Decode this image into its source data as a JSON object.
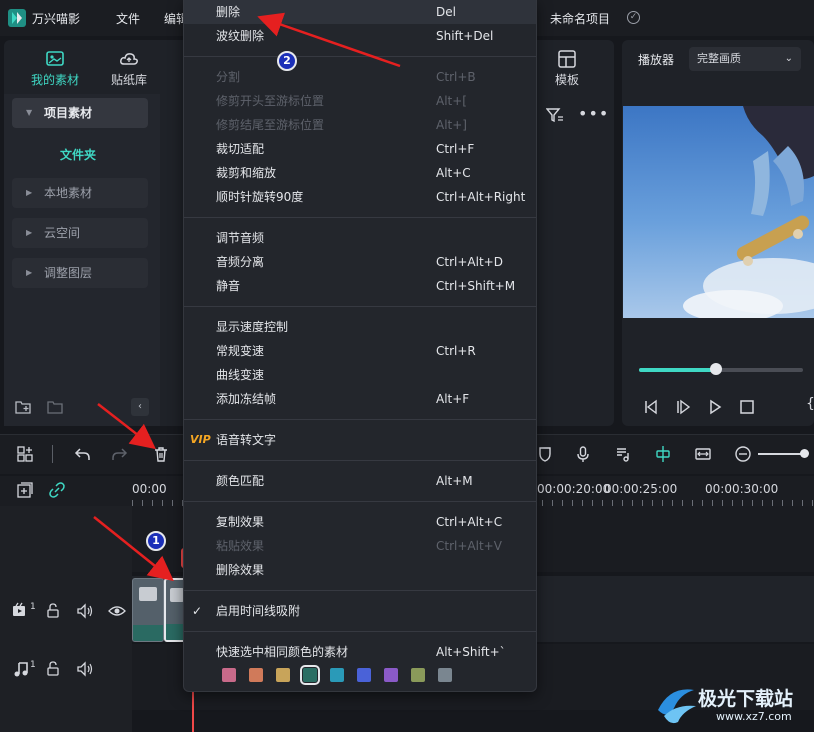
{
  "app": {
    "title": "万兴喵影",
    "menu_file": "文件",
    "menu_edit": "编辑",
    "project_name": "未命名项目",
    "project_saved_icon": "check-circle-icon"
  },
  "library": {
    "tabs": [
      {
        "label": "我的素材",
        "icon": "media-icon"
      },
      {
        "label": "贴纸库",
        "icon": "cloud-icon"
      },
      {
        "label": "模板",
        "icon": "template-icon"
      }
    ],
    "sidebar": {
      "project_media": "项目素材",
      "folder": "文件夹",
      "items": [
        "本地素材",
        "云空间",
        "调整图层"
      ]
    }
  },
  "player": {
    "label": "播放器",
    "quality": "完整画质",
    "progress": 0.47
  },
  "timeline": {
    "ruler": [
      "00:00",
      "00:00:20:00",
      "00:00:25:00",
      "00:00:30:00"
    ],
    "tracks": [
      {
        "type": "video",
        "number": "1"
      },
      {
        "type": "audio",
        "number": "1"
      }
    ]
  },
  "context_menu": {
    "groups": [
      [
        {
          "label": "删除",
          "shortcut": "Del",
          "enabled": true,
          "highlighted": true
        },
        {
          "label": "波纹删除",
          "shortcut": "Shift+Del",
          "enabled": true
        }
      ],
      [
        {
          "label": "分割",
          "shortcut": "Ctrl+B",
          "enabled": false
        },
        {
          "label": "修剪开头至游标位置",
          "shortcut": "Alt+[",
          "enabled": false
        },
        {
          "label": "修剪结尾至游标位置",
          "shortcut": "Alt+]",
          "enabled": false
        },
        {
          "label": "裁切适配",
          "shortcut": "Ctrl+F",
          "enabled": true
        },
        {
          "label": "裁剪和缩放",
          "shortcut": "Alt+C",
          "enabled": true
        },
        {
          "label": "顺时针旋转90度",
          "shortcut": "Ctrl+Alt+Right",
          "enabled": true
        }
      ],
      [
        {
          "label": "调节音频",
          "shortcut": "",
          "enabled": true
        },
        {
          "label": "音频分离",
          "shortcut": "Ctrl+Alt+D",
          "enabled": true
        },
        {
          "label": "静音",
          "shortcut": "Ctrl+Shift+M",
          "enabled": true
        }
      ],
      [
        {
          "label": "显示速度控制",
          "shortcut": "",
          "enabled": true
        },
        {
          "label": "常规变速",
          "shortcut": "Ctrl+R",
          "enabled": true
        },
        {
          "label": "曲线变速",
          "shortcut": "",
          "enabled": true
        },
        {
          "label": "添加冻结帧",
          "shortcut": "Alt+F",
          "enabled": true
        }
      ],
      [
        {
          "label": "语音转文字",
          "shortcut": "",
          "enabled": true,
          "badge": "VIP"
        }
      ],
      [
        {
          "label": "颜色匹配",
          "shortcut": "Alt+M",
          "enabled": true
        }
      ],
      [
        {
          "label": "复制效果",
          "shortcut": "Ctrl+Alt+C",
          "enabled": true
        },
        {
          "label": "粘贴效果",
          "shortcut": "Ctrl+Alt+V",
          "enabled": false
        },
        {
          "label": "删除效果",
          "shortcut": "",
          "enabled": true
        }
      ],
      [
        {
          "label": "启用时间线吸附",
          "shortcut": "",
          "enabled": true,
          "checked": true
        }
      ],
      [
        {
          "label": "快速选中相同颜色的素材",
          "shortcut": "Alt+Shift+`",
          "enabled": true
        }
      ]
    ],
    "color_swatches": [
      "#c86a8a",
      "#d07a5a",
      "#c8a45a",
      "#2a6e64",
      "#2a9ab8",
      "#4a62d8",
      "#8a5ac8",
      "#8a9a5a",
      "#7a8690"
    ],
    "selected_swatch": 3
  },
  "annotations": {
    "step1": "1",
    "step2": "2"
  },
  "watermark": {
    "name": "极光下载站",
    "url": "www.xz7.com"
  }
}
